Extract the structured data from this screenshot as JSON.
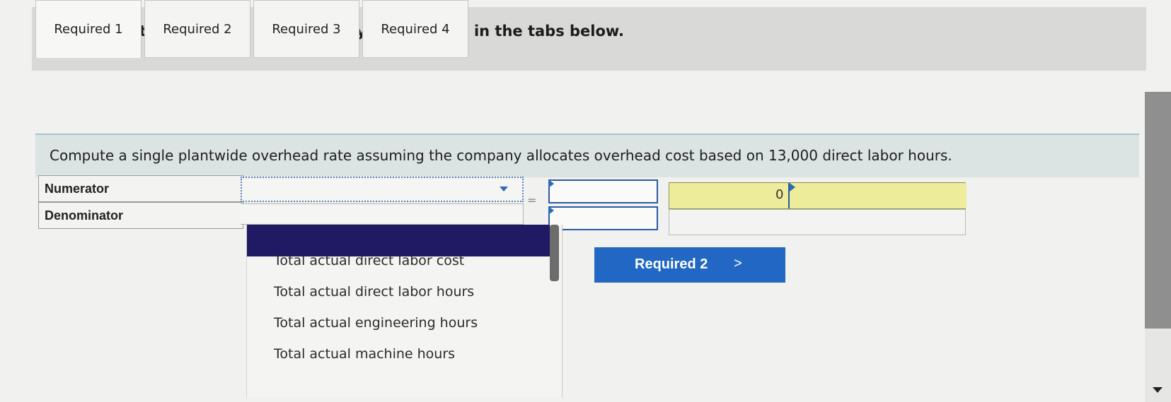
{
  "instructions": "Complete this question by entering your answers in the tabs below.",
  "tabs": [
    {
      "label": "Required 1"
    },
    {
      "label": "Required 2"
    },
    {
      "label": "Required 3"
    },
    {
      "label": "Required 4"
    }
  ],
  "question": "Compute a single plantwide overhead rate assuming the company allocates overhead cost based on 13,000 direct labor hours.",
  "form": {
    "numerator_label": "Numerator",
    "denominator_label": "Denominator",
    "equals": "=",
    "result_value": "0"
  },
  "dropdown": {
    "options": [
      "Total actual direct labor cost",
      "Total actual direct labor hours",
      "Total actual engineering hours",
      "Total actual machine hours"
    ]
  },
  "next_button": {
    "label": "Required 2",
    "chevron": ">"
  },
  "colors": {
    "tab_border": "#c7c7c5",
    "question_bg": "#dce3e3",
    "dropdown_highlight": "#1f1a63",
    "button_bg": "#2167c3",
    "result_bg": "#ecec9a"
  }
}
